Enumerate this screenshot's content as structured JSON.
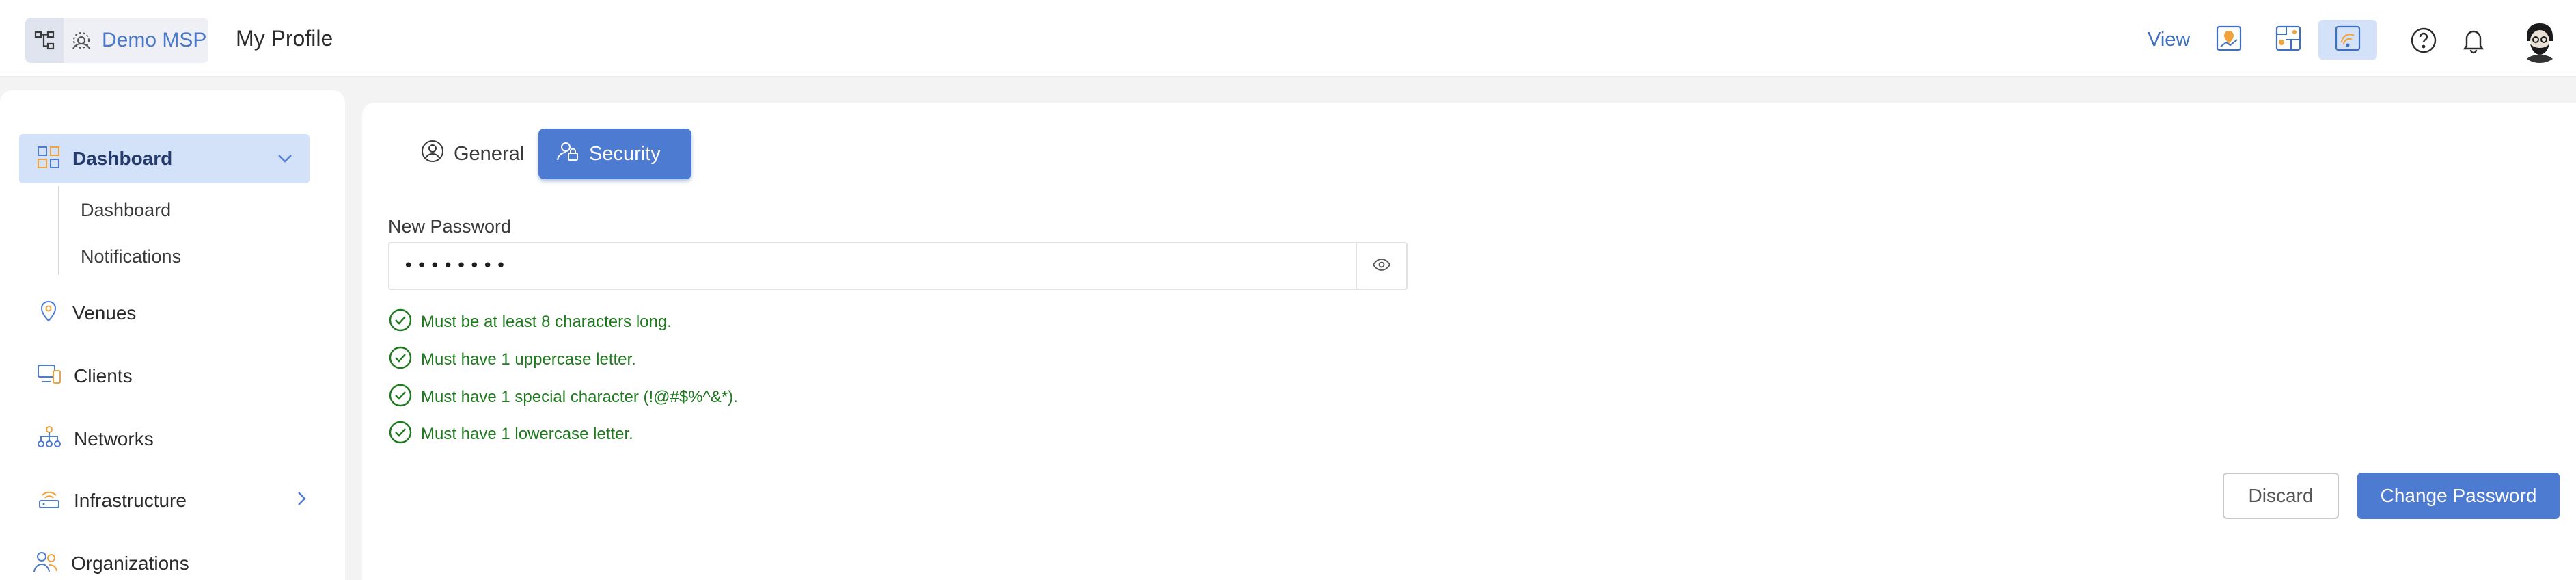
{
  "header": {
    "brand_name": "Demo MSP",
    "page_title": "My Profile",
    "view_label": "View",
    "view_buttons": [
      {
        "icon": "map-pin-view-icon",
        "active": false
      },
      {
        "icon": "floorplan-view-icon",
        "active": false
      },
      {
        "icon": "wireless-view-icon",
        "active": true
      }
    ],
    "icons": [
      "help-icon",
      "notification-bell-icon",
      "user-avatar"
    ]
  },
  "sidebar": {
    "items": [
      {
        "label": "Dashboard",
        "icon": "dashboard-grid-icon",
        "active": true,
        "expanded": true,
        "children": [
          {
            "label": "Dashboard"
          },
          {
            "label": "Notifications"
          }
        ]
      },
      {
        "label": "Venues",
        "icon": "location-pin-icon"
      },
      {
        "label": "Clients",
        "icon": "devices-icon"
      },
      {
        "label": "Networks",
        "icon": "network-topology-icon"
      },
      {
        "label": "Infrastructure",
        "icon": "access-point-icon",
        "has_submenu": true
      },
      {
        "label": "Organizations",
        "icon": "users-icon"
      }
    ]
  },
  "tabs": [
    {
      "label": "General",
      "icon": "user-circle-icon",
      "active": false
    },
    {
      "label": "Security",
      "icon": "user-lock-icon",
      "active": true
    }
  ],
  "password_form": {
    "label": "New Password",
    "value": "••••••••",
    "rules": [
      {
        "text": "Must be at least 8 characters long.",
        "met": true
      },
      {
        "text": "Must have 1 uppercase letter.",
        "met": true
      },
      {
        "text": "Must have 1 special character (!@#$%^&*).",
        "met": true
      },
      {
        "text": "Must have 1 lowercase letter.",
        "met": true
      }
    ]
  },
  "actions": {
    "discard_label": "Discard",
    "change_label": "Change Password"
  },
  "colors": {
    "accent": "#4d7bd2",
    "active_bg": "#d3e2f8",
    "success": "#1e7a1e",
    "background": "#f3f3f3"
  }
}
